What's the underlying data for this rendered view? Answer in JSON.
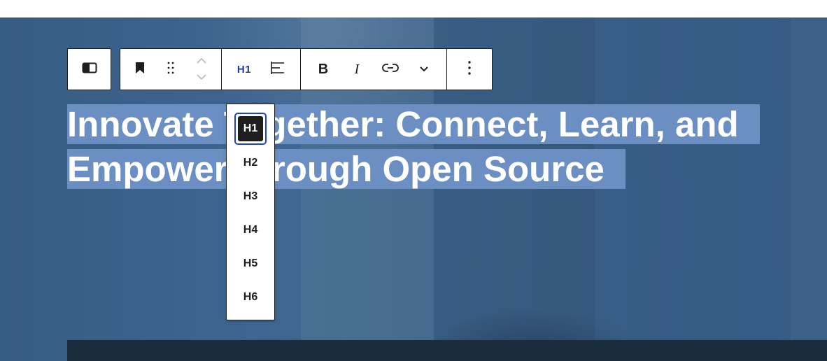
{
  "heading": {
    "text": "Innovate Together: Connect, Learn, and Empower through Open Source"
  },
  "toolbar": {
    "transform_icon": "column-block-icon",
    "bookmark_icon": "bookmark-icon",
    "drag_icon": "drag-handle-icon",
    "move_up_icon": "chevron-up-icon",
    "move_down_icon": "chevron-down-icon",
    "heading_level": "H1",
    "align_icon": "align-left-icon",
    "bold_label": "B",
    "italic_label": "I",
    "link_icon": "link-icon",
    "more_icon": "chevron-down-icon",
    "options_icon": "more-vertical-icon"
  },
  "heading_levels": {
    "items": [
      "H1",
      "H2",
      "H3",
      "H4",
      "H5",
      "H6"
    ],
    "selected": "H1"
  },
  "colors": {
    "selection": "#6b8fc2",
    "accent": "#1a44c4",
    "toolbar_border": "#1e1e1e"
  }
}
